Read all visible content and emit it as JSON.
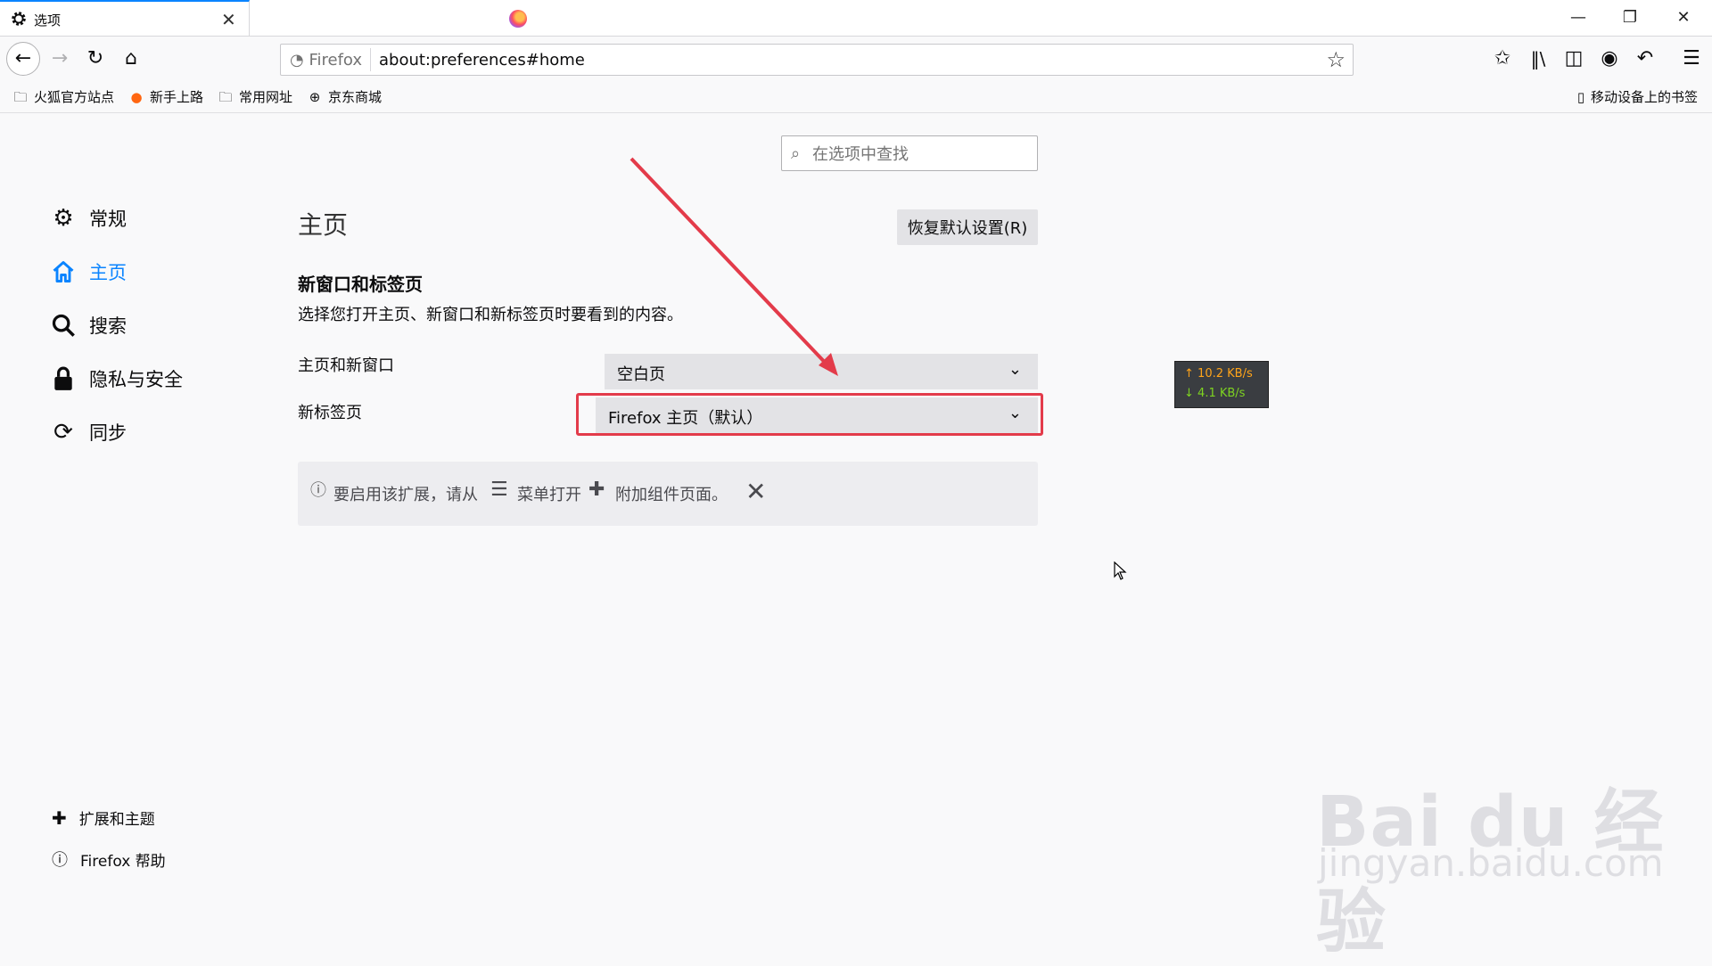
{
  "tab": {
    "title": "选项"
  },
  "url": {
    "identity": "Firefox",
    "text": "about:preferences#home"
  },
  "bookmarks": [
    {
      "label": "火狐官方站点",
      "icon": "folder-icon"
    },
    {
      "label": "新手上路",
      "icon": "firefox-icon"
    },
    {
      "label": "常用网址",
      "icon": "folder-icon"
    },
    {
      "label": "京东商城",
      "icon": "globe-icon"
    }
  ],
  "mobile_bookmarks": "移动设备上的书签",
  "search": {
    "placeholder": "在选项中查找"
  },
  "sidebar": {
    "categories": [
      {
        "label": "常规",
        "icon": "gear-icon"
      },
      {
        "label": "主页",
        "icon": "home-icon",
        "selected": true
      },
      {
        "label": "搜索",
        "icon": "search-icon"
      },
      {
        "label": "隐私与安全",
        "icon": "lock-icon"
      },
      {
        "label": "同步",
        "icon": "sync-icon"
      }
    ],
    "footer": [
      {
        "label": "扩展和主题",
        "icon": "puzzle-icon"
      },
      {
        "label": "Firefox 帮助",
        "icon": "help-icon"
      }
    ]
  },
  "main": {
    "title": "主页",
    "restore_label": "恢复默认设置(R)",
    "section_title": "新窗口和标签页",
    "section_desc": "选择您打开主页、新窗口和新标签页时要看到的内容。",
    "rows": [
      {
        "label": "主页和新窗口",
        "value": "空白页"
      },
      {
        "label": "新标签页",
        "value": "Firefox 主页（默认）"
      }
    ],
    "notice": {
      "part1": "要启用该扩展，请从",
      "part2": "菜单打开",
      "part3": "附加组件页面。"
    }
  },
  "speed": {
    "up": "10.2 KB/s",
    "down": "4.1 KB/s"
  },
  "watermark": {
    "main": "Bai du 经验",
    "sub": "jingyan.baidu.com"
  },
  "colors": {
    "accent": "#0a84ff",
    "highlight": "#e33b4a"
  }
}
